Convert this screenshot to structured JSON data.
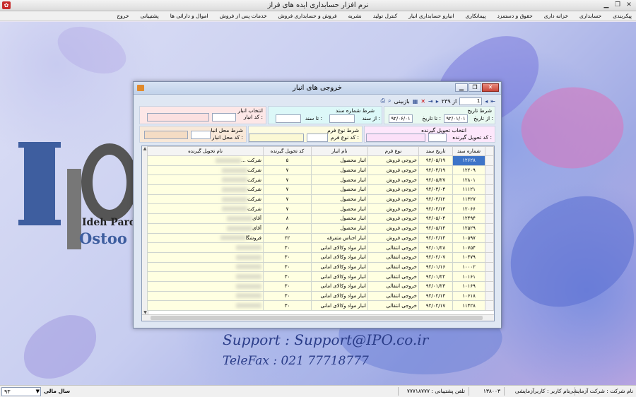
{
  "window": {
    "title": "نرم افزار حسابداری ایده های فراز"
  },
  "menu": [
    "پیکربندی",
    "حسابداری",
    "خزانه داری",
    "حقوق و دستمزد",
    "پیمانکاری",
    "انبارو حسابداری انبار",
    "کنترل تولید",
    "نشریه",
    "فروش و حسابداری فروش",
    "خدمات پس از فروش",
    "اموال و دارائی ها",
    "پشتیبانی",
    "خروج"
  ],
  "desktop": {
    "brand_line1": "Ideh Parda",
    "brand_line2": "Ostoo",
    "support": "Support  :  Support@IPO.co.ir",
    "telefax": "TeleFax  :  021 77718777"
  },
  "dialog": {
    "title": "خروجی های انبار",
    "nav": {
      "page_field": "1",
      "of_label": "از ۲۳۹",
      "refresh": "بازبینی"
    },
    "filters": {
      "date_header": "شرط تاریخ",
      "from_date_label": "از تاریخ :",
      "from_date": "۹۲/۰۱/۰۱",
      "to_date_label": "تا تاریخ :",
      "to_date": "۹۲/۰۶/۰۱",
      "docno_header": "شرط شماره سند",
      "from_doc_label": "از سند :",
      "to_doc_label": "تا سند :",
      "warehouse_header": "انتخاب انبار",
      "warehouse_code_label": "کد انبار :",
      "receiver_header": "انتخاب تحویل گیرنده",
      "receiver_code_label": "کد تحویل گیرنده :",
      "formtype_header": "شرط نوع فرم",
      "formtype_code_label": "کد نوع فرم :",
      "location_header": "شرط محل انبار",
      "location_code_label": "کد محل انبار :"
    },
    "table": {
      "columns": [
        "شماره سند",
        "تاریخ سند",
        "نوع فرم",
        "نام انبار",
        "کد تحویل گیرنده",
        "نام تحویل گیرنده"
      ],
      "rows": [
        [
          "۱۲۶۲۸",
          "۹۲/۰۵/۱۹",
          "خروجی فروش",
          "انبار محصول",
          "۵",
          "شرکت ..."
        ],
        [
          "۱۲۲۰۹",
          "۹۲/۰۴/۱۹",
          "خروجی فروش",
          "انبار محصول",
          "۷",
          "شرکت"
        ],
        [
          "۱۲۸۰۱",
          "۹۲/۰۵/۲۷",
          "خروجی فروش",
          "انبار محصول",
          "۷",
          "شرکت"
        ],
        [
          "۱۱۱۲۱",
          "۹۲/۰۳/۰۴",
          "خروجی فروش",
          "انبار محصول",
          "۷",
          "شرکت"
        ],
        [
          "۱۱۳۲۷",
          "۹۲/۰۳/۱۲",
          "خروجی فروش",
          "انبار محصول",
          "۷",
          "شرکت"
        ],
        [
          "۱۲۰۶۶",
          "۹۲/۰۴/۱۴",
          "خروجی فروش",
          "انبار محصول",
          "۷",
          "شرکت"
        ],
        [
          "۱۲۴۹۴",
          "۹۲/۰۵/۰۴",
          "خروجی فروش",
          "انبار محصول",
          "۸",
          "آقای"
        ],
        [
          "۱۲۵۲۹",
          "۹۲/۰۵/۱۴",
          "خروجی فروش",
          "انبار محصول",
          "۸",
          "آقای"
        ],
        [
          "۱۰۵۹۷",
          "۹۲/۰۲/۱۴",
          "خروجی فروش",
          "انبار اجناس متفرقه",
          "۲۲",
          "فروشگا"
        ],
        [
          "۱۰۷۵۴",
          "۹۲/۰۱/۲۸",
          "خروجی انتقالی",
          "انبار مواد وکالای امانی",
          "۳۰",
          ""
        ],
        [
          "۱۰۴۷۹",
          "۹۲/۰۲/۰۷",
          "خروجی انتقالی",
          "انبار مواد وکالای امانی",
          "۳۰",
          ""
        ],
        [
          "۱۰۰۰۲",
          "۹۲/۰۱/۱۶",
          "خروجی انتقالی",
          "انبار مواد وکالای امانی",
          "۳۰",
          ""
        ],
        [
          "۱۰۱۶۱",
          "۹۲/۰۱/۲۲",
          "خروجی انتقالی",
          "انبار مواد وکالای امانی",
          "۳۰",
          ""
        ],
        [
          "۱۰۱۶۹",
          "۹۲/۰۱/۲۳",
          "خروجی انتقالی",
          "انبار مواد وکالای امانی",
          "۳۰",
          ""
        ],
        [
          "۱۰۶۱۸",
          "۹۲/۰۲/۱۴",
          "خروجی انتقالی",
          "انبار مواد وکالای امانی",
          "۳۰",
          ""
        ],
        [
          "۱۱۴۲۸",
          "۹۲/۰۲/۱۷",
          "خروجی انتقالی",
          "انبار مواد وکالای امانی",
          "۳۰",
          ""
        ]
      ]
    }
  },
  "statusbar": {
    "company": "نام شرکت : شرکت آزمایشی",
    "user": "نام کاربر : کاربرآزمایشی",
    "version": "۱۳۸۰۰۳",
    "phone": "تلفن پشتیبانی : ۷۷۷۱۸۷۷۷",
    "fiscal_label": "سال مالی",
    "fiscal_year": "۹۳"
  }
}
